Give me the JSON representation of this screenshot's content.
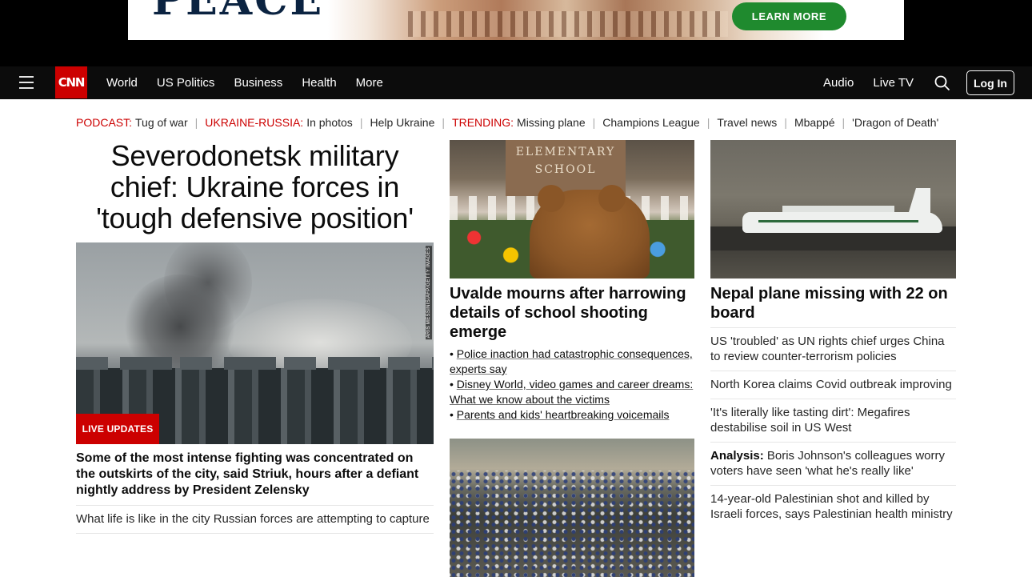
{
  "ad": {
    "logo_text": "PEACE",
    "cta_label": "LEARN MORE"
  },
  "nav": {
    "logo": "CNN",
    "links": [
      "World",
      "US Politics",
      "Business",
      "Health",
      "More"
    ],
    "right_links": [
      "Audio",
      "Live TV"
    ],
    "login_label": "Log In"
  },
  "trending": [
    {
      "kicker": "PODCAST:",
      "link": "Tug of war"
    },
    {
      "kicker": "UKRAINE-RUSSIA:",
      "link": "In photos"
    },
    {
      "kicker": "",
      "link": "Help Ukraine"
    },
    {
      "kicker": "TRENDING:",
      "link": "Missing plane"
    },
    {
      "kicker": "",
      "link": "Champions League"
    },
    {
      "kicker": "",
      "link": "Travel news"
    },
    {
      "kicker": "",
      "link": "Mbappé"
    },
    {
      "kicker": "",
      "link": "'Dragon of Death'"
    }
  ],
  "lead": {
    "headline": "Severodonetsk military chief: Ukraine forces in 'tough defensive position'",
    "photo_credit": "ARIS MESSINIS/AFP/GETTY IMAGES",
    "badge": "LIVE UPDATES",
    "subheadline": "Some of the most intense fighting was concentrated on the outskirts of the city, said Striuk, hours after a defiant nightly address by President Zelensky",
    "related": "What life is like in the city Russian forces are attempting to capture"
  },
  "col2": {
    "story1": {
      "sign_text": "ELEMENTARY SCHOOL",
      "headline": "Uvalde mourns after harrowing details of school shooting emerge",
      "bullets": [
        "Police inaction had catastrophic consequences, experts say",
        "Disney World, video games and career dreams: What we know about the victims",
        "Parents and kids' heartbreaking voicemails"
      ]
    }
  },
  "col3": {
    "headline": "Nepal plane missing with 22 on board",
    "items": [
      {
        "prefix": "",
        "text": "US 'troubled' as UN rights chief urges China to review counter-terrorism policies"
      },
      {
        "prefix": "",
        "text": "North Korea claims Covid outbreak improving"
      },
      {
        "prefix": "",
        "text": "'It's literally like tasting dirt': Megafires destabilise soil in US West"
      },
      {
        "prefix": "Analysis:",
        "text": " Boris Johnson's colleagues worry voters have seen 'what he's really like'"
      },
      {
        "prefix": "",
        "text": "14-year-old Palestinian shot and killed by Israeli forces, says Palestinian health ministry"
      }
    ]
  }
}
